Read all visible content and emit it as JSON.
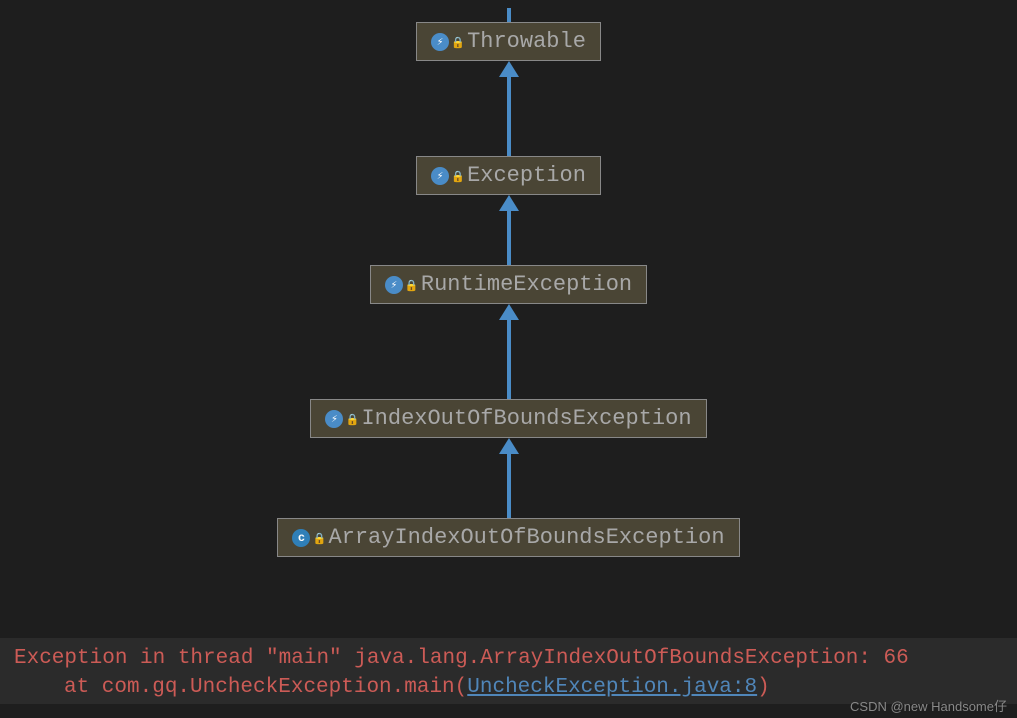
{
  "classes": [
    {
      "name": "Throwable",
      "icon": "lightning"
    },
    {
      "name": "Exception",
      "icon": "lightning"
    },
    {
      "name": "RuntimeException",
      "icon": "lightning"
    },
    {
      "name": "IndexOutOfBoundsException",
      "icon": "lightning"
    },
    {
      "name": "ArrayIndexOutOfBoundsException",
      "icon": "c"
    }
  ],
  "console": {
    "line1": "Exception in thread \"main\" java.lang.ArrayIndexOutOfBoundsException: 66",
    "line2_prefix": "at com.gq.UncheckException.main(",
    "line2_link": "UncheckException.java:8",
    "line2_suffix": ")"
  },
  "watermark": "CSDN @new Handsome仔"
}
